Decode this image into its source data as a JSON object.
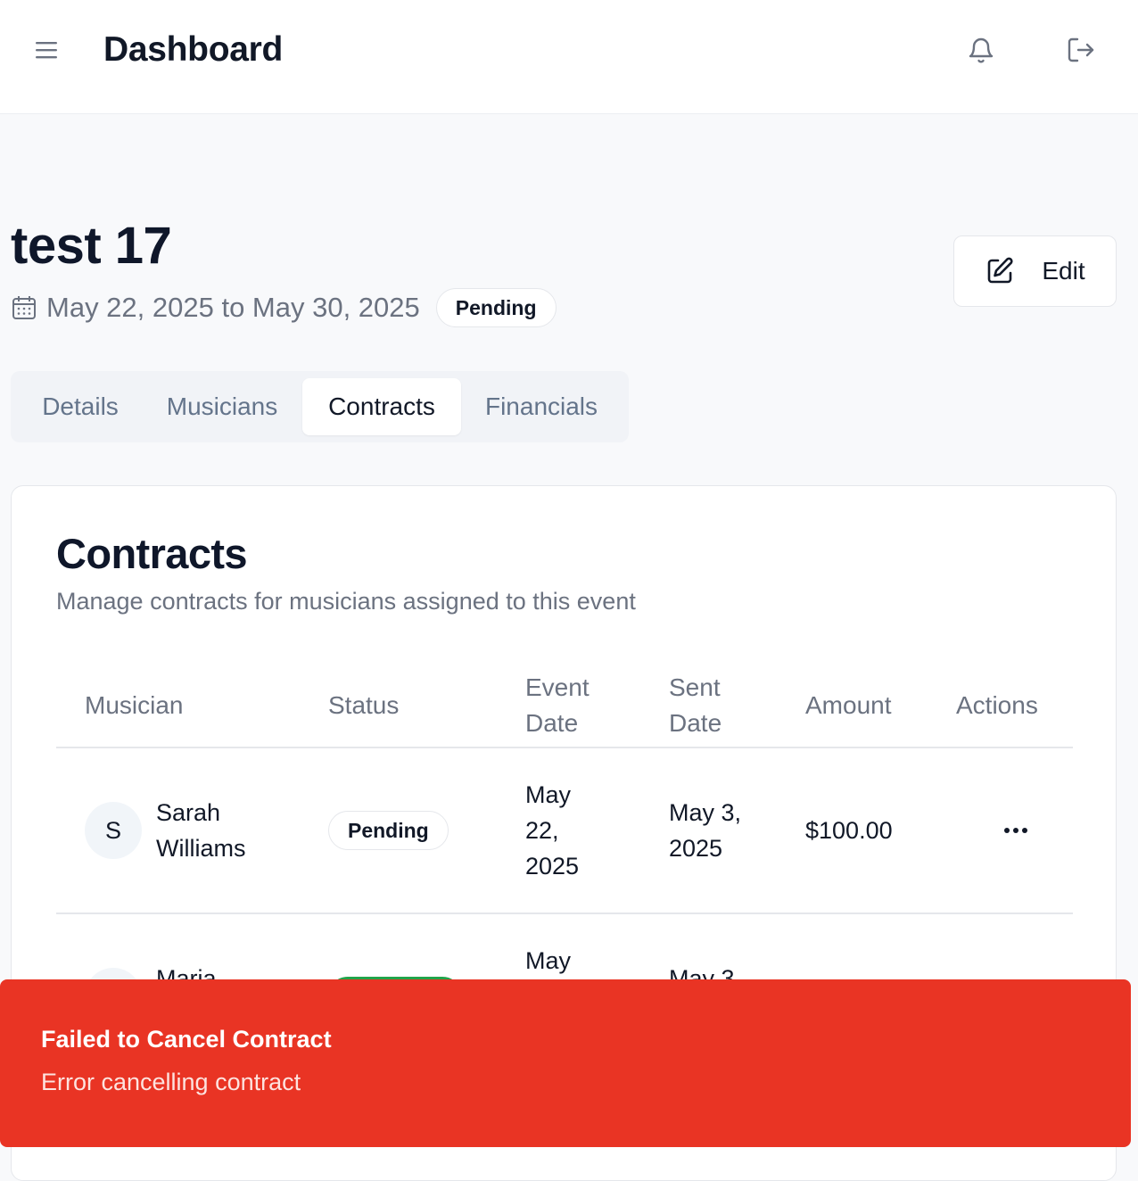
{
  "header": {
    "title": "Dashboard",
    "icons": [
      "menu-icon",
      "bell-icon",
      "logout-icon"
    ]
  },
  "event": {
    "title": "test 17",
    "date_range": "May 22, 2025 to May 30, 2025",
    "status": "Pending",
    "edit_label": "Edit"
  },
  "tabs": [
    {
      "label": "Details",
      "active": false
    },
    {
      "label": "Musicians",
      "active": false
    },
    {
      "label": "Contracts",
      "active": true
    },
    {
      "label": "Financials",
      "active": false
    }
  ],
  "contracts": {
    "title": "Contracts",
    "subtitle": "Manage contracts for musicians assigned to this event",
    "columns": {
      "musician": "Musician",
      "status": "Status",
      "event_date_1": "Event",
      "event_date_2": "Date",
      "sent_date_1": "Sent",
      "sent_date_2": "Date",
      "amount": "Amount",
      "actions": "Actions"
    },
    "rows": [
      {
        "initial": "S",
        "name_1": "Sarah",
        "name_2": "Williams",
        "status": "Pending",
        "event_date_1": "May",
        "event_date_2": "22,",
        "event_date_3": "2025",
        "sent_date_1": "May 3,",
        "sent_date_2": "2025",
        "amount": "$100.00"
      },
      {
        "initial": "",
        "name_1": "Maria",
        "status": "",
        "event_date_1": "May",
        "sent_date_1": "May 3,"
      }
    ]
  },
  "toast": {
    "title": "Failed to Cancel Contract",
    "description": "Error cancelling contract",
    "color": "#e93424"
  },
  "colors": {
    "status_active_green": "#22a34a",
    "muted_text": "#6b7280"
  }
}
